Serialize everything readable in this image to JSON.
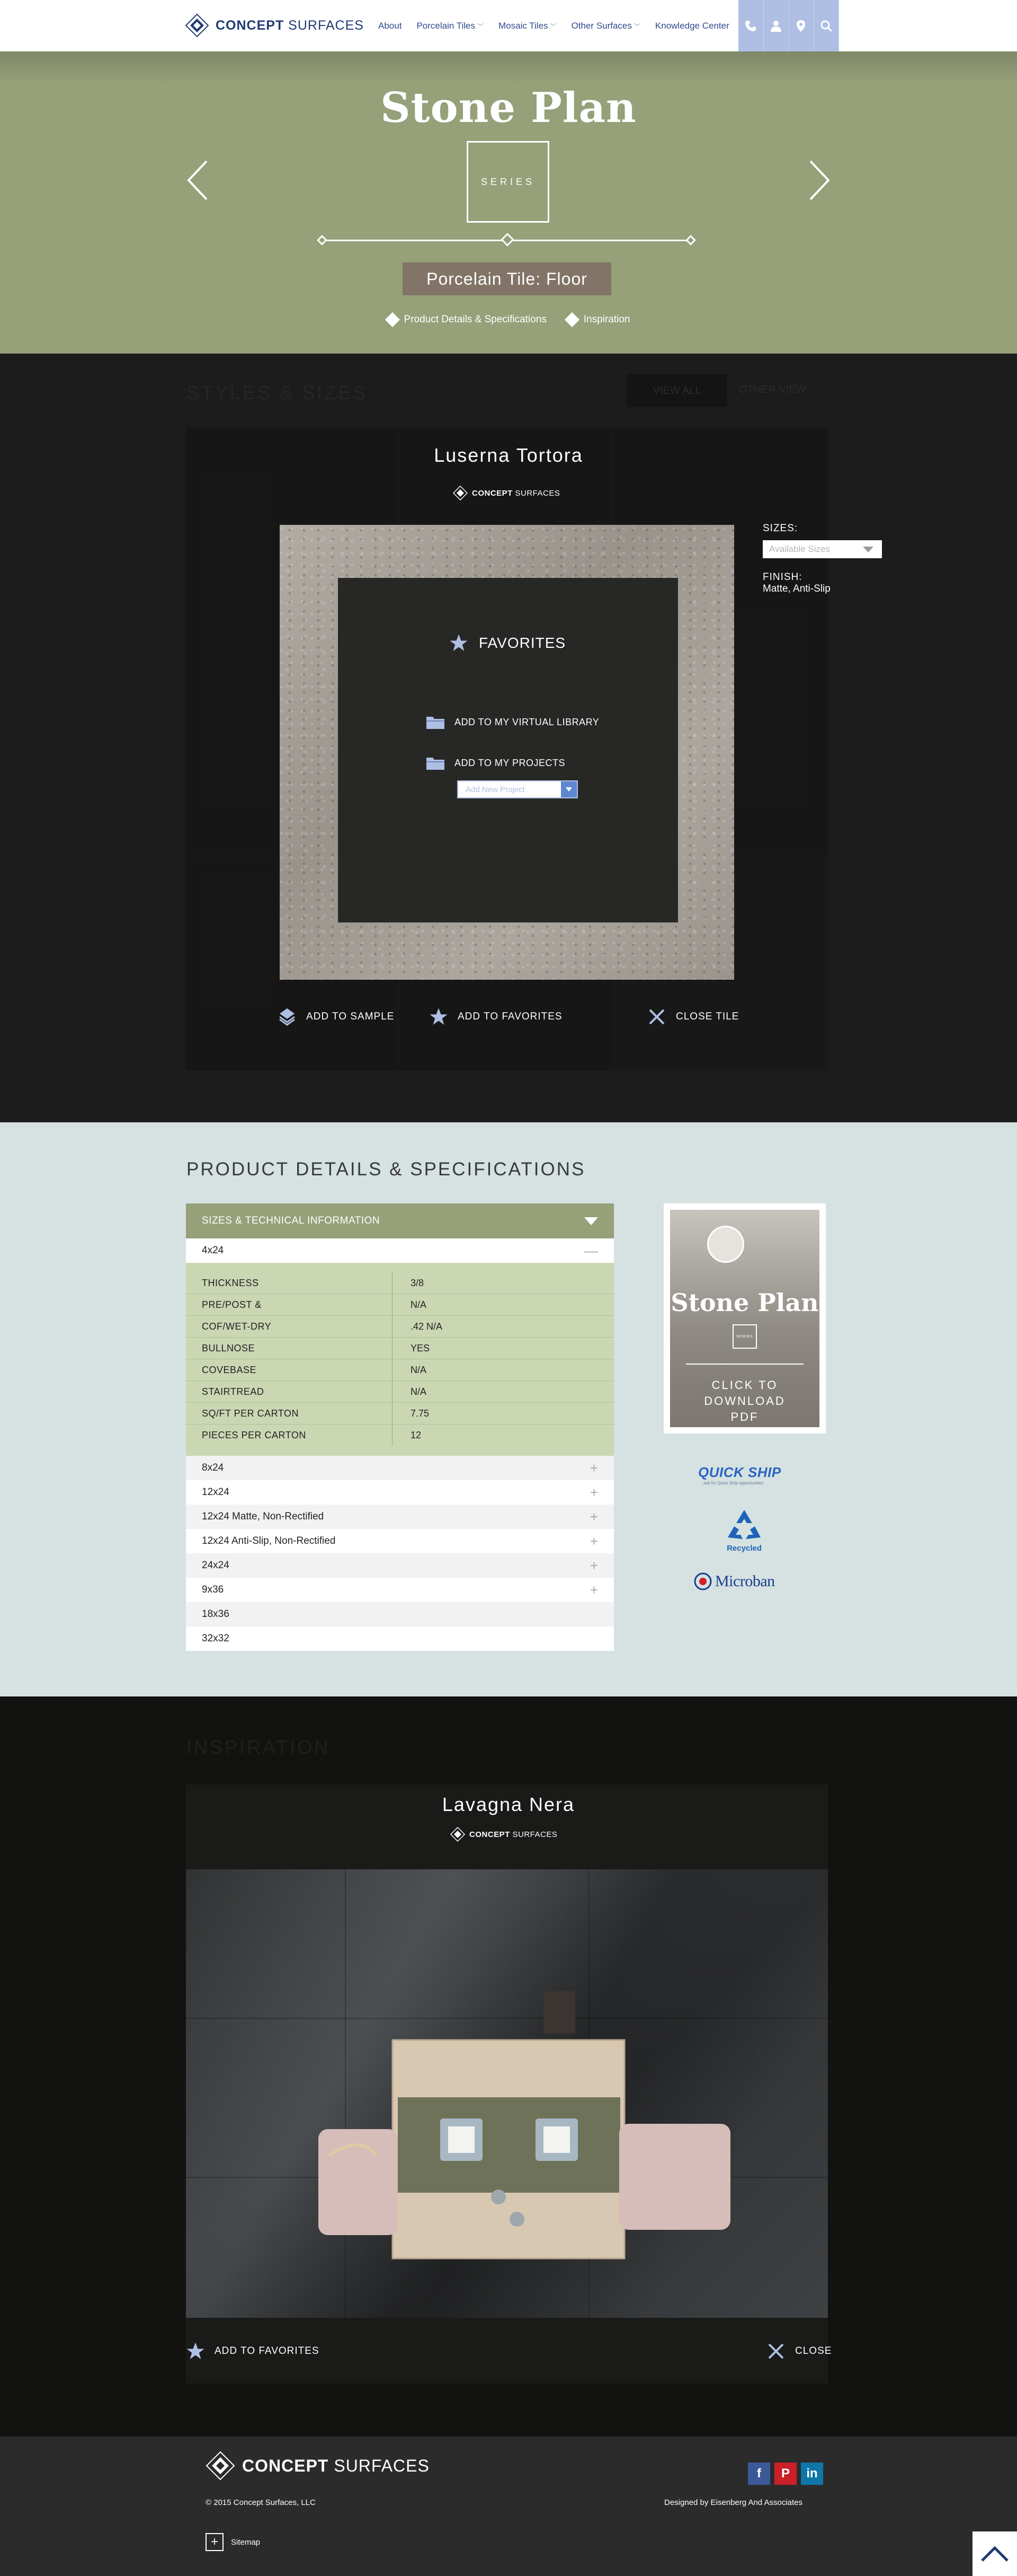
{
  "header": {
    "brand_bold": "CONCEPT",
    "brand_rest": " SURFACES",
    "nav": [
      {
        "label": "About",
        "dropdown": false
      },
      {
        "label": "Porcelain Tiles",
        "dropdown": true
      },
      {
        "label": "Mosaic Tiles",
        "dropdown": true
      },
      {
        "label": "Other Surfaces",
        "dropdown": true
      },
      {
        "label": "Knowledge Center",
        "dropdown": false
      }
    ],
    "tools": [
      "phone-icon",
      "user-icon",
      "location-pin-icon",
      "search-icon"
    ]
  },
  "hero": {
    "title": "Stone Plan",
    "series_label": "SERIES",
    "subtitle": "Porcelain Tile: Floor",
    "links": [
      "Product Details & Specifications",
      "Inspiration"
    ],
    "background_color": "#96a079"
  },
  "styles": {
    "heading": "STYLES & SIZES",
    "view_all": "VIEW ALL",
    "view_other": "OTHER VIEW",
    "tile_name": "Luserna Tortora",
    "logo_bold": "CONCEPT",
    "logo_rest": " SURFACES",
    "favorites": {
      "title": "FAVORITES",
      "add_library": "ADD TO MY VIRTUAL LIBRARY",
      "add_projects": "ADD TO MY PROJECTS",
      "project_placeholder": "Add New Project"
    },
    "sizes_label": "SIZES:",
    "sizes_placeholder": "Available Sizes",
    "finish_label": "FINISH:",
    "finish_value": "Matte, Anti-Slip",
    "actions": {
      "sample": "ADD TO SAMPLE",
      "favorites": "ADD TO FAVORITES",
      "close": "CLOSE TILE"
    }
  },
  "details": {
    "heading": "PRODUCT DETAILS & SPECIFICATIONS",
    "table_header": "SIZES & TECHNICAL INFORMATION",
    "open_size": "4x24",
    "specs": [
      {
        "k": "THICKNESS",
        "v": "3/8"
      },
      {
        "k": "PRE/POST &",
        "v": "N/A"
      },
      {
        "k": "COF/WET-DRY",
        "v": ".42 N/A"
      },
      {
        "k": "BULLNOSE",
        "v": "YES"
      },
      {
        "k": "COVEBASE",
        "v": "N/A"
      },
      {
        "k": "STAIRTREAD",
        "v": "N/A"
      },
      {
        "k": "SQ/FT PER CARTON",
        "v": "7.75"
      },
      {
        "k": "PIECES PER CARTON",
        "v": "12"
      }
    ],
    "sizes": [
      {
        "label": "8x24",
        "expandable": true
      },
      {
        "label": "12x24",
        "expandable": true
      },
      {
        "label": "12x24 Matte, Non-Rectified",
        "expandable": true
      },
      {
        "label": "12x24 Anti-Slip, Non-Rectified",
        "expandable": true
      },
      {
        "label": "24x24",
        "expandable": true
      },
      {
        "label": "9x36",
        "expandable": true
      },
      {
        "label": "18x36",
        "expandable": false
      },
      {
        "label": "32x32",
        "expandable": false
      }
    ],
    "pdf": {
      "title": "Stone Plan",
      "series": "SERIES",
      "cta_lines": [
        "CLICK TO",
        "DOWNLOAD",
        "PDF"
      ]
    },
    "badges": {
      "quickship": "QUICK SHIP",
      "quickship_sub": "ask for Quick Ship opportunities",
      "recycled": "Recycled",
      "microban": "Microban"
    }
  },
  "inspiration": {
    "heading": "INSPIRATION",
    "name": "Lavagna Nera",
    "logo_bold": "CONCEPT",
    "logo_rest": " SURFACES",
    "add_favorites": "ADD TO FAVORITES",
    "close": "CLOSE"
  },
  "footer": {
    "brand_bold": "CONCEPT",
    "brand_rest": " SURFACES",
    "copyright": "© 2015 Concept Surfaces, LLC",
    "designed_by": "Designed by Eisenberg And Associates",
    "sitemap": "Sitemap",
    "social": [
      {
        "name": "facebook-icon",
        "glyph": "f",
        "color": "#3b5998"
      },
      {
        "name": "pinterest-icon",
        "glyph": "P",
        "color": "#cb2027"
      },
      {
        "name": "linkedin-icon",
        "glyph": "in",
        "color": "#0e76a8"
      }
    ]
  },
  "colors": {
    "accent_blue": "#aebfe3",
    "olive": "#96a079",
    "spec_green": "#cbd6b3",
    "details_bg": "#d5e2e1"
  }
}
